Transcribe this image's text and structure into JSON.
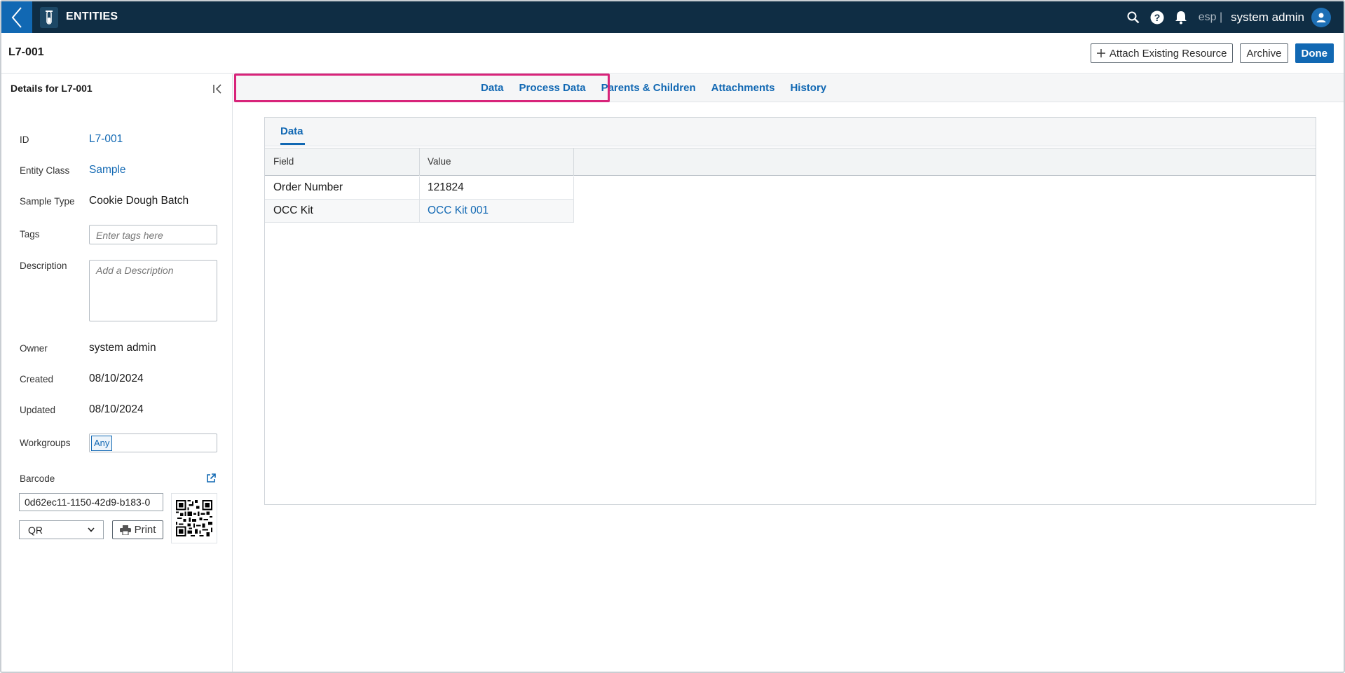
{
  "topnav": {
    "app_title": "ENTITIES",
    "tenant": "esp |",
    "user_name": "system admin",
    "icons": [
      "back-chevron-icon",
      "test-tube-icon",
      "search-icon",
      "help-icon",
      "bell-icon",
      "user-avatar-icon"
    ],
    "brand_color": "#0f2d44",
    "accent_color": "#1168b3"
  },
  "header": {
    "title": "L7-001",
    "attach_label": "Attach Existing Resource",
    "archive_label": "Archive",
    "done_label": "Done"
  },
  "details": {
    "title": "Details for L7-001",
    "id_label": "ID",
    "id_value": "L7-001",
    "entity_class_label": "Entity Class",
    "entity_class_value": "Sample",
    "sample_type_label": "Sample Type",
    "sample_type_value": "Cookie Dough Batch",
    "tags_label": "Tags",
    "tags_placeholder": "Enter tags here",
    "description_label": "Description",
    "description_placeholder": "Add a Description",
    "owner_label": "Owner",
    "owner_value": "system admin",
    "created_label": "Created",
    "created_value": "08/10/2024",
    "updated_label": "Updated",
    "updated_value": "08/10/2024",
    "workgroups_label": "Workgroups",
    "workgroup_chip": "Any",
    "barcode_label": "Barcode",
    "barcode_value": "0d62ec11-1150-42d9-b183-0",
    "barcode_type": "QR",
    "print_label": "Print"
  },
  "tabs": [
    "Data",
    "Process Data",
    "Parents & Children",
    "Attachments",
    "History"
  ],
  "highlight_color": "#d8247a",
  "data_card": {
    "tab_label": "Data",
    "columns": [
      "Field",
      "Value"
    ],
    "rows": [
      {
        "field": "Order Number",
        "value": "121824",
        "is_link": false
      },
      {
        "field": "OCC Kit",
        "value": "OCC Kit 001",
        "is_link": true
      }
    ]
  }
}
